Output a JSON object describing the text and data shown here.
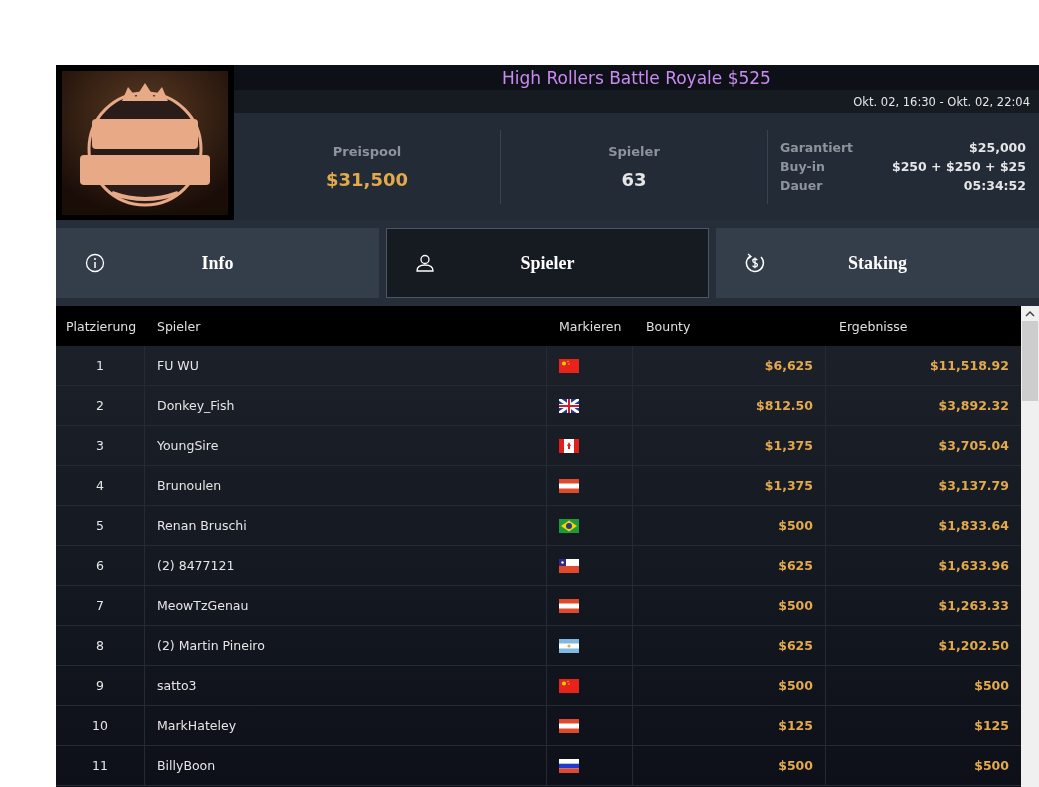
{
  "header": {
    "title": "High Rollers Battle Royale $525",
    "dates": "Okt. 02, 16:30 - Okt. 02, 22:04"
  },
  "stats": [
    {
      "label": "Preispool",
      "value": "$31,500",
      "kind": "money"
    },
    {
      "label": "Spieler",
      "value": "63",
      "kind": "count"
    }
  ],
  "details": [
    {
      "label": "Garantiert",
      "value": "$25,000"
    },
    {
      "label": "Buy-in",
      "value": "$250 + $250 + $25"
    },
    {
      "label": "Dauer",
      "value": "05:34:52"
    }
  ],
  "tabs": [
    {
      "label": "Info",
      "kind": "info",
      "selected": false
    },
    {
      "label": "Spieler",
      "kind": "user",
      "selected": true
    },
    {
      "label": "Staking",
      "kind": "dollar",
      "selected": false
    }
  ],
  "table": {
    "columns": [
      "Platzierung",
      "Spieler",
      "Markieren",
      "Bounty",
      "Ergebnisse"
    ],
    "rows": [
      {
        "place": "1",
        "player": "FU WU",
        "kind": "cn",
        "bounty": "$6,625",
        "result": "$11,518.92"
      },
      {
        "place": "2",
        "player": "Donkey_Fish",
        "kind": "gb",
        "bounty": "$812.50",
        "result": "$3,892.32"
      },
      {
        "place": "3",
        "player": "YoungSire",
        "kind": "ca",
        "bounty": "$1,375",
        "result": "$3,705.04"
      },
      {
        "place": "4",
        "player": "Brunoulen",
        "kind": "at",
        "bounty": "$1,375",
        "result": "$3,137.79"
      },
      {
        "place": "5",
        "player": "Renan Bruschi",
        "kind": "br",
        "bounty": "$500",
        "result": "$1,833.64"
      },
      {
        "place": "6",
        "player": "(2) 8477121",
        "kind": "cl",
        "bounty": "$625",
        "result": "$1,633.96"
      },
      {
        "place": "7",
        "player": "MeowTzGenau",
        "kind": "at",
        "bounty": "$500",
        "result": "$1,263.33"
      },
      {
        "place": "8",
        "player": "(2) Martin Pineiro",
        "kind": "ar",
        "bounty": "$625",
        "result": "$1,202.50"
      },
      {
        "place": "9",
        "player": "satto3",
        "kind": "cn",
        "bounty": "$500",
        "result": "$500"
      },
      {
        "place": "10",
        "player": "MarkHateley",
        "kind": "at",
        "bounty": "$125",
        "result": "$125"
      },
      {
        "place": "11",
        "player": "BillyBoon",
        "kind": "ru",
        "bounty": "$500",
        "result": "$500"
      }
    ]
  }
}
